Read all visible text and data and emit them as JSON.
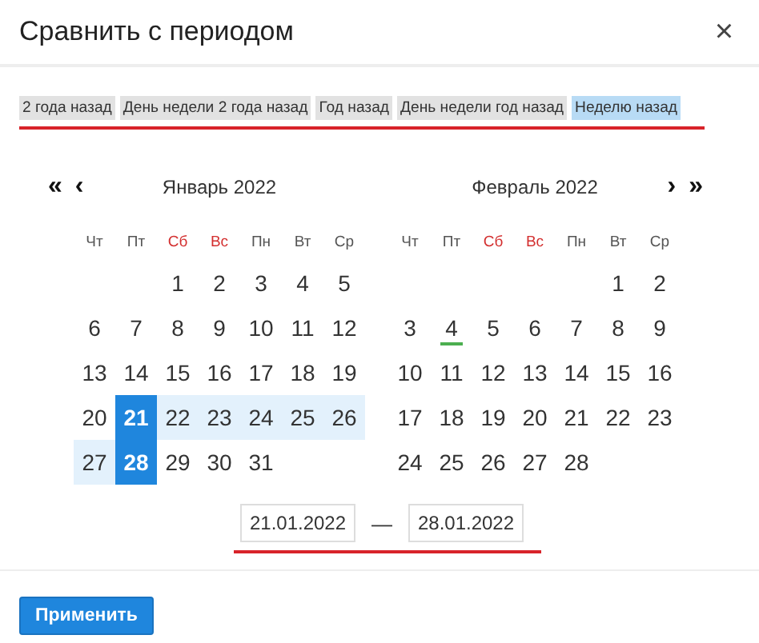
{
  "dialog": {
    "title": "Сравнить с периодом",
    "close": "×"
  },
  "presets": [
    {
      "label": "2 года назад",
      "selected": false
    },
    {
      "label": "День недели 2 года назад",
      "selected": false
    },
    {
      "label": "Год назад",
      "selected": false
    },
    {
      "label": "День недели год назад",
      "selected": false
    },
    {
      "label": "Неделю назад",
      "selected": true
    }
  ],
  "months": [
    {
      "title": "Январь 2022",
      "nav": [
        "«",
        "‹"
      ],
      "weekdays": [
        {
          "label": "Чт",
          "weekend": false
        },
        {
          "label": "Пт",
          "weekend": false
        },
        {
          "label": "Сб",
          "weekend": true
        },
        {
          "label": "Вс",
          "weekend": true
        },
        {
          "label": "Пн",
          "weekend": false
        },
        {
          "label": "Вт",
          "weekend": false
        },
        {
          "label": "Ср",
          "weekend": false
        }
      ],
      "weeks": [
        {
          "right_aligned": true,
          "days": [
            {
              "day": "1",
              "selected": false,
              "in_range": false,
              "today": false
            },
            {
              "day": "2",
              "selected": false,
              "in_range": false,
              "today": false
            },
            {
              "day": "3",
              "selected": false,
              "in_range": false,
              "today": false
            },
            {
              "day": "4",
              "selected": false,
              "in_range": false,
              "today": false
            },
            {
              "day": "5",
              "selected": false,
              "in_range": false,
              "today": false
            }
          ]
        },
        {
          "right_aligned": false,
          "days": [
            {
              "day": "6",
              "selected": false,
              "in_range": false,
              "today": false
            },
            {
              "day": "7",
              "selected": false,
              "in_range": false,
              "today": false
            },
            {
              "day": "8",
              "selected": false,
              "in_range": false,
              "today": false
            },
            {
              "day": "9",
              "selected": false,
              "in_range": false,
              "today": false
            },
            {
              "day": "10",
              "selected": false,
              "in_range": false,
              "today": false
            },
            {
              "day": "11",
              "selected": false,
              "in_range": false,
              "today": false
            },
            {
              "day": "12",
              "selected": false,
              "in_range": false,
              "today": false
            }
          ]
        },
        {
          "right_aligned": false,
          "days": [
            {
              "day": "13",
              "selected": false,
              "in_range": false,
              "today": false
            },
            {
              "day": "14",
              "selected": false,
              "in_range": false,
              "today": false
            },
            {
              "day": "15",
              "selected": false,
              "in_range": false,
              "today": false
            },
            {
              "day": "16",
              "selected": false,
              "in_range": false,
              "today": false
            },
            {
              "day": "17",
              "selected": false,
              "in_range": false,
              "today": false
            },
            {
              "day": "18",
              "selected": false,
              "in_range": false,
              "today": false
            },
            {
              "day": "19",
              "selected": false,
              "in_range": false,
              "today": false
            }
          ]
        },
        {
          "right_aligned": false,
          "days": [
            {
              "day": "20",
              "selected": false,
              "in_range": false,
              "today": false
            },
            {
              "day": "21",
              "selected": true,
              "in_range": true,
              "today": false
            },
            {
              "day": "22",
              "selected": false,
              "in_range": true,
              "today": false
            },
            {
              "day": "23",
              "selected": false,
              "in_range": true,
              "today": false
            },
            {
              "day": "24",
              "selected": false,
              "in_range": true,
              "today": false
            },
            {
              "day": "25",
              "selected": false,
              "in_range": true,
              "today": false
            },
            {
              "day": "26",
              "selected": false,
              "in_range": true,
              "today": false
            }
          ]
        },
        {
          "right_aligned": false,
          "days": [
            {
              "day": "27",
              "selected": false,
              "in_range": true,
              "today": false
            },
            {
              "day": "28",
              "selected": true,
              "in_range": true,
              "today": false
            },
            {
              "day": "29",
              "selected": false,
              "in_range": false,
              "today": false
            },
            {
              "day": "30",
              "selected": false,
              "in_range": false,
              "today": false
            },
            {
              "day": "31",
              "selected": false,
              "in_range": false,
              "today": false
            }
          ]
        }
      ]
    },
    {
      "title": "Февраль 2022",
      "nav": [
        "›",
        "»"
      ],
      "weekdays": [
        {
          "label": "Чт",
          "weekend": false
        },
        {
          "label": "Пт",
          "weekend": false
        },
        {
          "label": "Сб",
          "weekend": true
        },
        {
          "label": "Вс",
          "weekend": true
        },
        {
          "label": "Пн",
          "weekend": false
        },
        {
          "label": "Вт",
          "weekend": false
        },
        {
          "label": "Ср",
          "weekend": false
        }
      ],
      "weeks": [
        {
          "right_aligned": true,
          "days": [
            {
              "day": "1",
              "selected": false,
              "in_range": false,
              "today": false
            },
            {
              "day": "2",
              "selected": false,
              "in_range": false,
              "today": false
            }
          ]
        },
        {
          "right_aligned": false,
          "days": [
            {
              "day": "3",
              "selected": false,
              "in_range": false,
              "today": false
            },
            {
              "day": "4",
              "selected": false,
              "in_range": false,
              "today": true
            },
            {
              "day": "5",
              "selected": false,
              "in_range": false,
              "today": false
            },
            {
              "day": "6",
              "selected": false,
              "in_range": false,
              "today": false
            },
            {
              "day": "7",
              "selected": false,
              "in_range": false,
              "today": false
            },
            {
              "day": "8",
              "selected": false,
              "in_range": false,
              "today": false
            },
            {
              "day": "9",
              "selected": false,
              "in_range": false,
              "today": false
            }
          ]
        },
        {
          "right_aligned": false,
          "days": [
            {
              "day": "10",
              "selected": false,
              "in_range": false,
              "today": false
            },
            {
              "day": "11",
              "selected": false,
              "in_range": false,
              "today": false
            },
            {
              "day": "12",
              "selected": false,
              "in_range": false,
              "today": false
            },
            {
              "day": "13",
              "selected": false,
              "in_range": false,
              "today": false
            },
            {
              "day": "14",
              "selected": false,
              "in_range": false,
              "today": false
            },
            {
              "day": "15",
              "selected": false,
              "in_range": false,
              "today": false
            },
            {
              "day": "16",
              "selected": false,
              "in_range": false,
              "today": false
            }
          ]
        },
        {
          "right_aligned": false,
          "days": [
            {
              "day": "17",
              "selected": false,
              "in_range": false,
              "today": false
            },
            {
              "day": "18",
              "selected": false,
              "in_range": false,
              "today": false
            },
            {
              "day": "19",
              "selected": false,
              "in_range": false,
              "today": false
            },
            {
              "day": "20",
              "selected": false,
              "in_range": false,
              "today": false
            },
            {
              "day": "21",
              "selected": false,
              "in_range": false,
              "today": false
            },
            {
              "day": "22",
              "selected": false,
              "in_range": false,
              "today": false
            },
            {
              "day": "23",
              "selected": false,
              "in_range": false,
              "today": false
            }
          ]
        },
        {
          "right_aligned": false,
          "days": [
            {
              "day": "24",
              "selected": false,
              "in_range": false,
              "today": false
            },
            {
              "day": "25",
              "selected": false,
              "in_range": false,
              "today": false
            },
            {
              "day": "26",
              "selected": false,
              "in_range": false,
              "today": false
            },
            {
              "day": "27",
              "selected": false,
              "in_range": false,
              "today": false
            },
            {
              "day": "28",
              "selected": false,
              "in_range": false,
              "today": false
            }
          ]
        }
      ]
    }
  ],
  "range": {
    "from": "21.01.2022",
    "separator": "—",
    "to": "28.01.2022"
  },
  "apply_button": "Применить"
}
